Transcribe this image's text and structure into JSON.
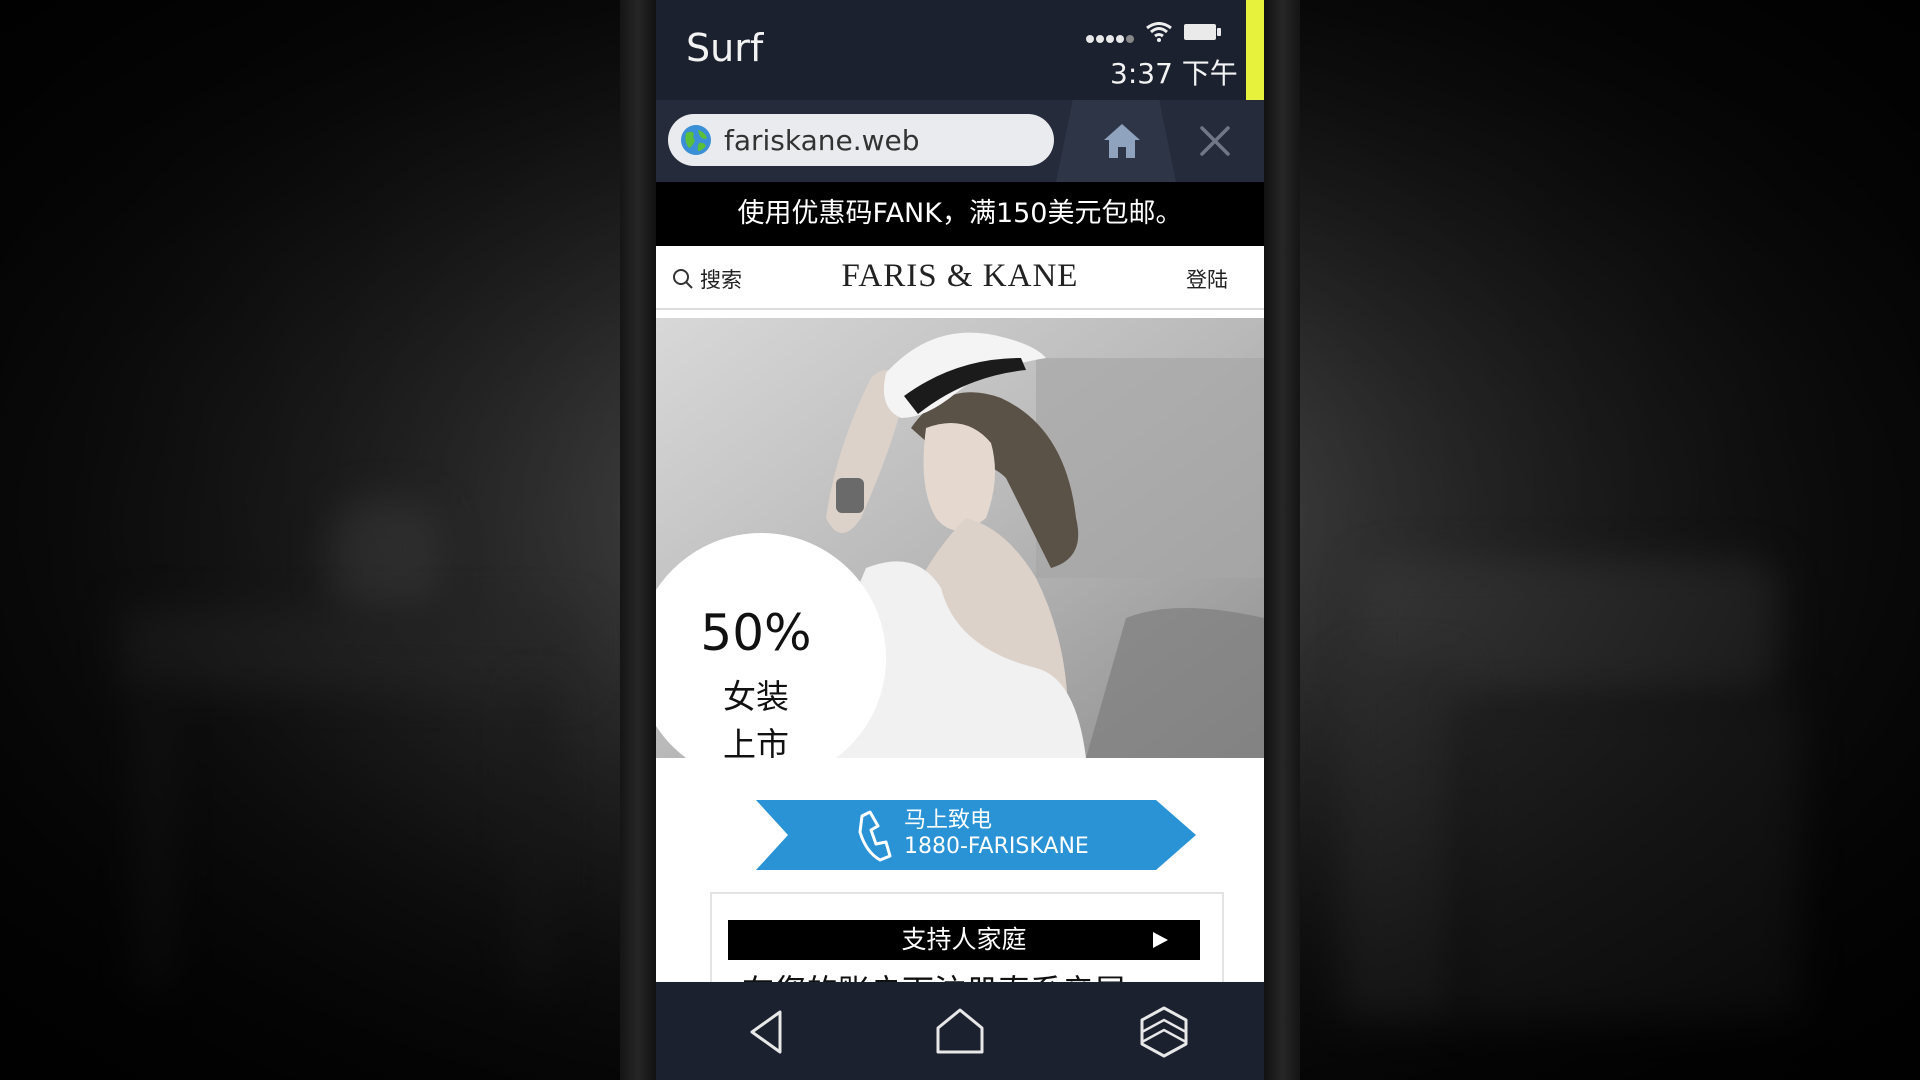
{
  "statusbar": {
    "app_title": "Surf",
    "time": "3:37 下午",
    "accent_color": "#e6f23c"
  },
  "browser": {
    "url": "fariskane.web",
    "globe_icon": "globe-icon",
    "home_icon": "home-icon",
    "close_icon": "close-icon"
  },
  "site": {
    "promo_text": "使用优惠码FANK，满150美元包邮。",
    "search_label": "搜索",
    "brand": "FARIS & KANE",
    "login_label": "登陆",
    "hero": {
      "percent": "50%",
      "line1": "女装",
      "line2": "上市"
    },
    "call": {
      "line1": "马上致电",
      "line2": "1880-FARISKANE",
      "color": "#2a93d5",
      "icon": "phone-icon"
    },
    "card": {
      "title": "支持人家庭",
      "text": "在您的账户下注册直系亲属。"
    }
  },
  "navbar": {
    "back_icon": "back-icon",
    "home_icon": "home-outline-icon",
    "apps_icon": "hexagon-apps-icon"
  }
}
